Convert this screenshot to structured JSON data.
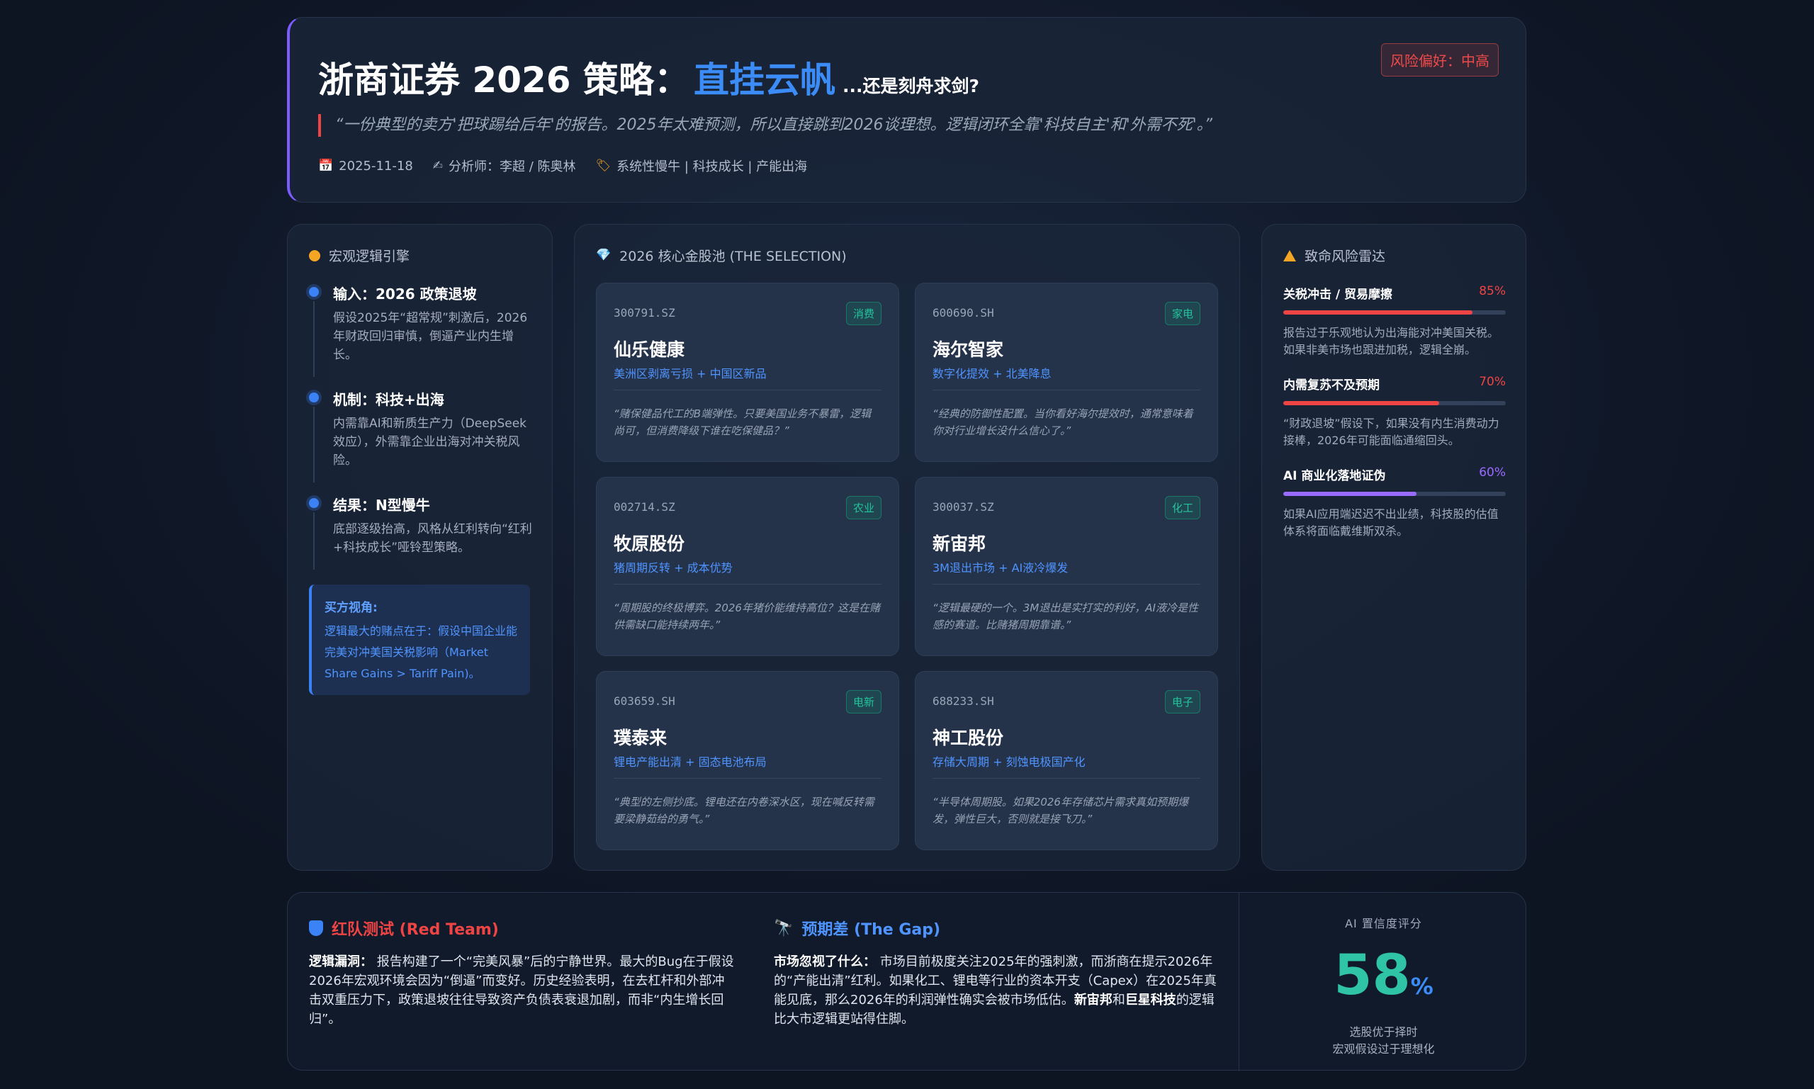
{
  "header": {
    "title_main": "浙商证券 2026 策略：",
    "title_accent": "直挂云帆",
    "title_sub": "...还是刻舟求剑?",
    "risk_badge": "风险偏好：中高",
    "quote": "“一份典型的卖方'把球踢给后年'的报告。2025年太难预测，所以直接跳到2026谈理想。逻辑闭环全靠'科技自主'和'外需不死'。”",
    "date": "2025-11-18",
    "analysts": "分析师：李超 / 陈奥林",
    "tags": "系统性慢牛 | 科技成长 | 产能出海",
    "icons": {
      "date": "calendar-icon",
      "analyst": "writing-hand-icon",
      "tags": "tag-icon"
    }
  },
  "macro": {
    "title": "宏观逻辑引擎",
    "steps": [
      {
        "title": "输入：2026 政策退坡",
        "desc": "假设2025年“超常规”刺激后，2026年财政回归审慎，倒逼产业内生增长。"
      },
      {
        "title": "机制：科技+出海",
        "desc": "内需靠AI和新质生产力（DeepSeek效应），外需靠企业出海对冲关税风险。"
      },
      {
        "title": "结果：N型慢牛",
        "desc": "底部逐级抬高，风格从红利转向“红利+科技成长”哑铃型策略。"
      }
    ],
    "buyer_title": "买方视角:",
    "buyer_text": "逻辑最大的赌点在于：假设中国企业能完美对冲美国关税影响（Market Share Gains > Tariff Pain)。"
  },
  "pool": {
    "title": "2026 核心金股池 (THE SELECTION)",
    "stocks": [
      {
        "code": "300791.SZ",
        "tag": "消费",
        "name": "仙乐健康",
        "theme": "美洲区剥离亏损 + 中国区新品",
        "note": "“赌保健品代工的B端弹性。只要美国业务不暴雷，逻辑尚可，但消费降级下谁在吃保健品？”"
      },
      {
        "code": "600690.SH",
        "tag": "家电",
        "name": "海尔智家",
        "theme": "数字化提效 + 北美降息",
        "note": "“经典的防御性配置。当你看好海尔提效时，通常意味着你对行业增长没什么信心了。”"
      },
      {
        "code": "002714.SZ",
        "tag": "农业",
        "name": "牧原股份",
        "theme": "猪周期反转 + 成本优势",
        "note": "“周期股的终极博弈。2026年猪价能维持高位？这是在赌供需缺口能持续两年。”"
      },
      {
        "code": "300037.SZ",
        "tag": "化工",
        "name": "新宙邦",
        "theme": "3M退出市场 + AI液冷爆发",
        "note": "“逻辑最硬的一个。3M退出是实打实的利好，AI液冷是性感的赛道。比赌猪周期靠谱。”"
      },
      {
        "code": "603659.SH",
        "tag": "电新",
        "name": "璞泰来",
        "theme": "锂电产能出清 + 固态电池布局",
        "note": "“典型的左侧抄底。锂电还在内卷深水区，现在喊反转需要梁静茹给的勇气。”"
      },
      {
        "code": "688233.SH",
        "tag": "电子",
        "name": "神工股份",
        "theme": "存储大周期 + 刻蚀电极国产化",
        "note": "“半导体周期股。如果2026年存储芯片需求真如预期爆发，弹性巨大，否则就是接飞刀。”"
      }
    ]
  },
  "risk": {
    "title": "致命风险雷达",
    "items": [
      {
        "name": "关税冲击 / 贸易摩擦",
        "pct_label": "85%",
        "pct": 85,
        "color": "#ef4444",
        "desc": "报告过于乐观地认为出海能对冲美国关税。如果非美市场也跟进加税，逻辑全崩。"
      },
      {
        "name": "内需复苏不及预期",
        "pct_label": "70%",
        "pct": 70,
        "color": "#ef4444",
        "desc": "“财政退坡”假设下，如果没有内生消费动力接棒，2026年可能面临通缩回头。"
      },
      {
        "name": "AI 商业化落地证伪",
        "pct_label": "60%",
        "pct": 60,
        "color": "#9a6bff",
        "desc": "如果AI应用端迟迟不出业绩，科技股的估值体系将面临戴维斯双杀。"
      }
    ]
  },
  "bottom": {
    "red_team_title": "红队测试 (Red Team)",
    "red_team_lead": "逻辑漏洞：",
    "red_team_text": "报告构建了一个“完美风暴”后的宁静世界。最大的Bug在于假设2026年宏观环境会因为“倒逼”而变好。历史经验表明，在去杠杆和外部冲击双重压力下，政策退坡往往导致资产负债表衰退加剧，而非“内生增长回归”。",
    "gap_title": "预期差 (The Gap)",
    "gap_lead": "市场忽视了什么：",
    "gap_text_1": "市场目前极度关注2025年的强刺激，而浙商在提示2026年的“产能出清”红利。如果化工、锂电等行业的资本开支（Capex）在2025年真能见底，那么2026年的利润弹性确实会被市场低估。",
    "gap_bold_1": "新宙邦",
    "gap_mid": "和",
    "gap_bold_2": "巨星科技",
    "gap_text_2": "的逻辑比大市逻辑更站得住脚。",
    "score_label": "AI 置信度评分",
    "score": "58",
    "score_unit": "%",
    "score_desc_1": "选股优于择时",
    "score_desc_2": "宏观假设过于理想化"
  }
}
